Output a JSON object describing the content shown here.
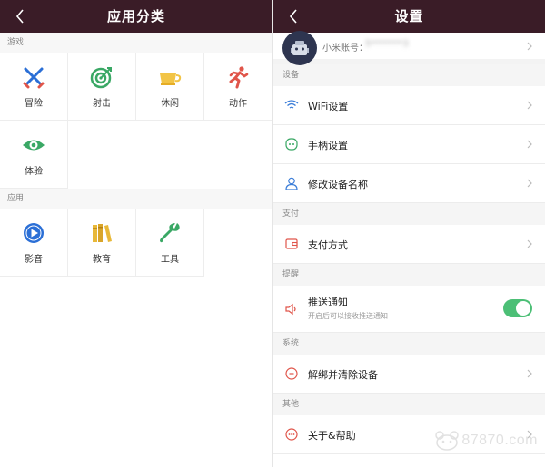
{
  "left": {
    "title": "应用分类",
    "sections": [
      {
        "label": "游戏",
        "items": [
          {
            "label": "冒险",
            "icon": "swords-icon"
          },
          {
            "label": "射击",
            "icon": "target-icon"
          },
          {
            "label": "休闲",
            "icon": "cup-icon"
          },
          {
            "label": "动作",
            "icon": "running-man-icon"
          },
          {
            "label": "体验",
            "icon": "eye-icon"
          }
        ]
      },
      {
        "label": "应用",
        "items": [
          {
            "label": "影音",
            "icon": "play-icon"
          },
          {
            "label": "教育",
            "icon": "books-icon"
          },
          {
            "label": "工具",
            "icon": "wrench-icon"
          }
        ]
      }
    ]
  },
  "right": {
    "title": "设置",
    "account": {
      "label": "小米账号：",
      "value": "5*******3"
    },
    "groups": [
      {
        "label": "设备",
        "rows": [
          {
            "label": "WiFi设置",
            "icon": "wifi-icon"
          },
          {
            "label": "手柄设置",
            "icon": "gamepad-icon"
          },
          {
            "label": "修改设备名称",
            "icon": "person-icon"
          }
        ]
      },
      {
        "label": "支付",
        "rows": [
          {
            "label": "支付方式",
            "icon": "wallet-icon"
          }
        ]
      },
      {
        "label": "提醒",
        "rows": [
          {
            "label": "推送通知",
            "sub": "开启后可以接收推送通知",
            "icon": "speaker-icon",
            "toggle": true
          }
        ]
      },
      {
        "label": "系统",
        "rows": [
          {
            "label": "解绑并清除设备",
            "icon": "unbind-icon"
          }
        ]
      },
      {
        "label": "其他",
        "rows": [
          {
            "label": "关于&帮助",
            "icon": "more-icon"
          }
        ]
      }
    ]
  },
  "watermark": "87870.com",
  "colors": {
    "topbar": "#3a1c27",
    "toggle_on": "#4cbf76",
    "accent_red": "#e0554a",
    "accent_blue": "#3b7dd8",
    "accent_green": "#3aa865",
    "accent_yellow": "#e8b838"
  }
}
